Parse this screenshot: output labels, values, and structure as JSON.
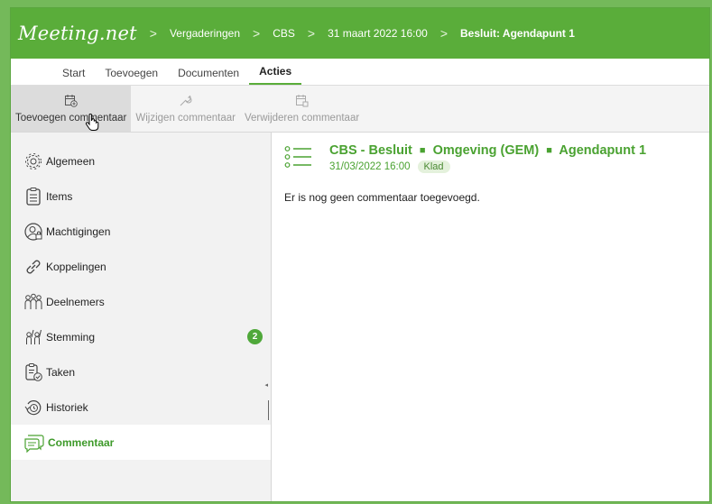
{
  "header": {
    "logo": "Meeting.net",
    "breadcrumbs": [
      {
        "label": "Vergaderingen"
      },
      {
        "label": "CBS"
      },
      {
        "label": "31 maart 2022 16:00"
      },
      {
        "label": "Besluit: Agendapunt 1"
      }
    ],
    "separator": ">"
  },
  "tabs": [
    {
      "label": "Start"
    },
    {
      "label": "Toevoegen"
    },
    {
      "label": "Documenten"
    },
    {
      "label": "Acties",
      "active": true
    }
  ],
  "ribbon": {
    "add_comment": "Toevoegen commentaar",
    "edit_comment": "Wijzigen commentaar",
    "delete_comment": "Verwijderen commentaar"
  },
  "sidebar": {
    "items": [
      {
        "label": "Algemeen",
        "icon": "gear-icon"
      },
      {
        "label": "Items",
        "icon": "clipboard-list-icon"
      },
      {
        "label": "Machtigingen",
        "icon": "user-lock-icon"
      },
      {
        "label": "Koppelingen",
        "icon": "link-icon"
      },
      {
        "label": "Deelnemers",
        "icon": "group-icon"
      },
      {
        "label": "Stemming",
        "icon": "voting-icon",
        "badge": "2"
      },
      {
        "label": "Taken",
        "icon": "task-check-icon"
      },
      {
        "label": "Historiek",
        "icon": "history-icon"
      },
      {
        "label": "Commentaar",
        "icon": "comments-icon",
        "active": true
      }
    ]
  },
  "main": {
    "title_parts": [
      "CBS - Besluit",
      "Omgeving (GEM)",
      "Agendapunt 1"
    ],
    "title_separator": "■",
    "date": "31/03/2022 16:00",
    "status": "Klad",
    "empty_message": "Er is nog geen commentaar toegevoegd."
  },
  "colors": {
    "brand_green": "#5aad3a",
    "accent_green": "#4aa231",
    "badge_green": "#4fa83a"
  }
}
